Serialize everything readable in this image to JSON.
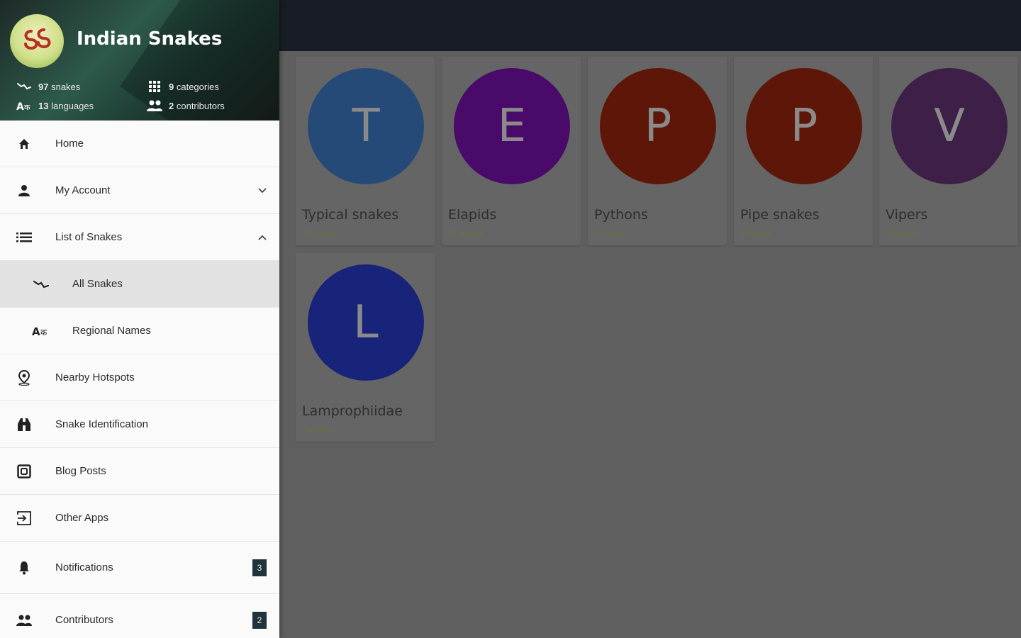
{
  "app": {
    "title": "Indian Snakes",
    "stats": [
      {
        "value": "97",
        "label": "snakes",
        "icon": "snake-icon"
      },
      {
        "value": "9",
        "label": "categories",
        "icon": "grid-icon"
      },
      {
        "value": "13",
        "label": "languages",
        "icon": "translate-icon"
      },
      {
        "value": "2",
        "label": "contributors",
        "icon": "people-icon"
      }
    ]
  },
  "menu": [
    {
      "label": "Home",
      "icon": "home-icon"
    },
    {
      "label": "My Account",
      "icon": "person-icon",
      "expand": "down"
    },
    {
      "label": "List of Snakes",
      "icon": "list-icon",
      "expand": "up"
    },
    {
      "label": "All Snakes",
      "icon": "snake-icon",
      "sub": true,
      "selected": true
    },
    {
      "label": "Regional Names",
      "icon": "translate-icon",
      "sub": true
    },
    {
      "label": "Nearby Hotspots",
      "icon": "location-pin-icon"
    },
    {
      "label": "Snake Identification",
      "icon": "binoculars-icon"
    },
    {
      "label": "Blog Posts",
      "icon": "blog-icon"
    },
    {
      "label": "Other Apps",
      "icon": "exit-to-app-icon"
    },
    {
      "label": "Notifications",
      "icon": "bell-icon",
      "badge": "3"
    },
    {
      "label": "Contributors",
      "icon": "people-icon",
      "badge": "2"
    }
  ],
  "categories": [
    {
      "letter": "T",
      "name": "Typical snakes",
      "count": "29 snakes",
      "color": "#264a78"
    },
    {
      "letter": "E",
      "name": "Elapids",
      "count": "11 snakes",
      "color": "#4a0a6a"
    },
    {
      "letter": "P",
      "name": "Pythons",
      "count": "3 snakes",
      "color": "#5e1608"
    },
    {
      "letter": "P",
      "name": "Pipe snakes",
      "count": "2 snakes",
      "color": "#5e1608"
    },
    {
      "letter": "V",
      "name": "Vipers",
      "count": "5 snakes",
      "color": "#3e1f48"
    },
    {
      "letter": "L",
      "name": "Lamprophiidae",
      "count": "2 snakes",
      "color": "#18237a"
    }
  ],
  "colors": {
    "topbar": "#181c24",
    "overlay_background": "#5f5f5f",
    "drawer_background": "#fafafa",
    "selected_item": "#e2e2e2",
    "badge": "#21343c"
  }
}
